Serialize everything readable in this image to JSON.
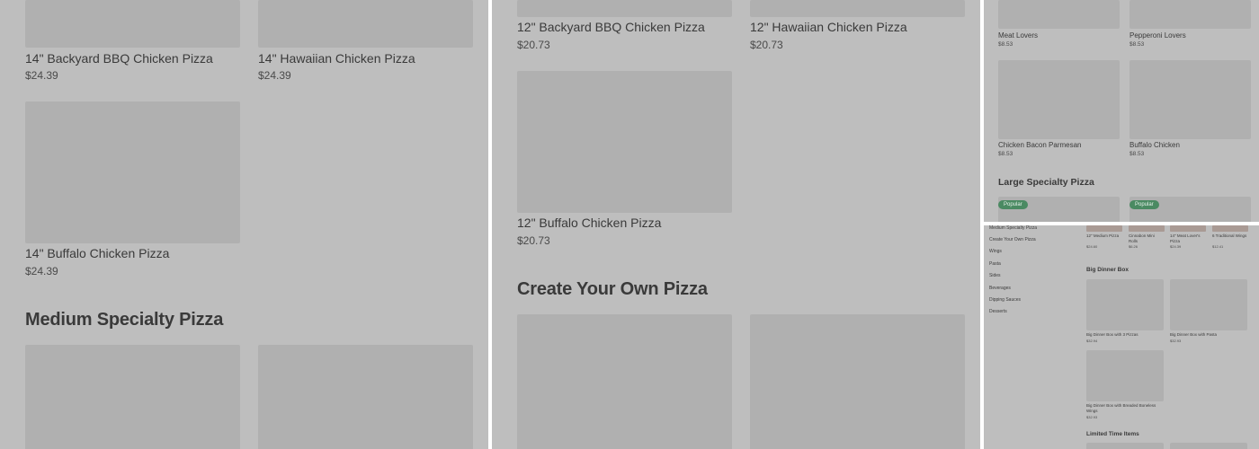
{
  "panel1": {
    "items": [
      {
        "name": "14\" Backyard BBQ Chicken Pizza",
        "price": "$24.39"
      },
      {
        "name": "14\" Hawaiian Chicken Pizza",
        "price": "$24.39"
      },
      {
        "name": "14\" Buffalo Chicken Pizza",
        "price": "$24.39"
      }
    ],
    "section_heading": "Medium Specialty Pizza"
  },
  "panel2": {
    "items": [
      {
        "name": "12\" Backyard BBQ Chicken Pizza",
        "price": "$20.73"
      },
      {
        "name": "12\" Hawaiian Chicken Pizza",
        "price": "$20.73"
      },
      {
        "name": "12\" Buffalo Chicken Pizza",
        "price": "$20.73"
      }
    ],
    "section_heading": "Create Your Own Pizza"
  },
  "panel3": {
    "items": [
      {
        "name": "Meat Lovers",
        "price": "$8.53"
      },
      {
        "name": "Pepperoni Lovers",
        "price": "$8.53"
      },
      {
        "name": "Chicken Bacon Parmesan",
        "price": "$8.53"
      },
      {
        "name": "Buffalo Chicken",
        "price": "$8.53"
      }
    ],
    "section_heading": "Large Specialty Pizza",
    "badges": [
      "Popular",
      "Popular"
    ]
  },
  "panel4": {
    "sidebar": [
      "Medium Specialty Pizza",
      "Create Your Own Pizza",
      "Wings",
      "Pasta",
      "Sides",
      "Beverages",
      "Dipping Sauces",
      "Desserts"
    ],
    "top_items": [
      {
        "name": "12\" Medium Pizza",
        "price": "$24.60"
      },
      {
        "name": "Cinnabon Mini Rolls",
        "price": "$6.26"
      },
      {
        "name": "14\" Meat Lover's Pizza",
        "price": "$24.39"
      },
      {
        "name": "6 Traditional Wings",
        "price": "$12.41"
      }
    ],
    "section1_heading": "Big Dinner Box",
    "box_items": [
      {
        "name": "Big Dinner Box with 3 Pizzas",
        "price": "$32.94"
      },
      {
        "name": "Big Dinner Box with Pasta",
        "price": "$32.93"
      },
      {
        "name": "Big Dinner Box with Breaded Boneless Wings",
        "price": "$32.93"
      }
    ],
    "section2_heading": "Limited Time Items"
  },
  "colors": {
    "overlay": "#bebebe",
    "placeholder": "#b0b0b0",
    "badge": "#4a8a62",
    "divider": "#ffffff"
  }
}
